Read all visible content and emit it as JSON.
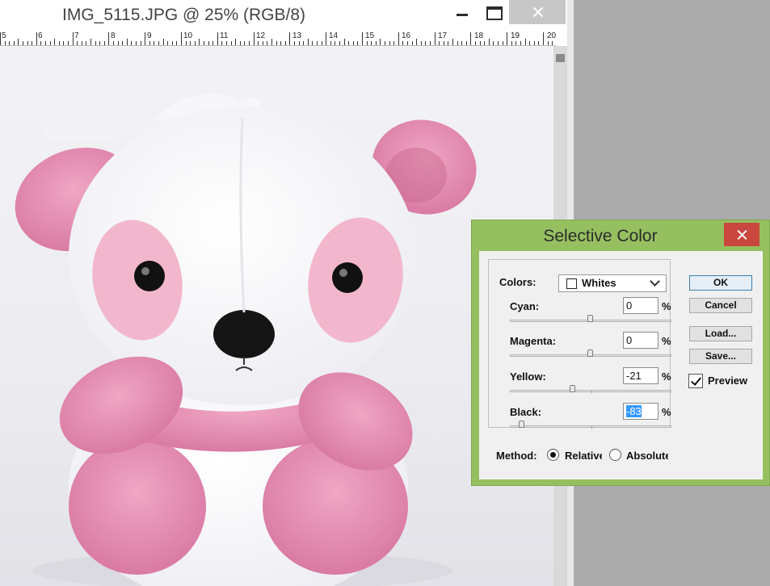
{
  "document": {
    "title": "IMG_5115.JPG @ 25% (RGB/8)",
    "ruler_labels": [
      "5",
      "6",
      "7",
      "8",
      "9",
      "10",
      "11",
      "12",
      "13",
      "14",
      "15",
      "16",
      "17",
      "18",
      "19",
      "20"
    ]
  },
  "colors": {
    "dialog_frame": "#96c060",
    "close_red": "#c9473e",
    "selection_blue": "#3399ff",
    "plush_pink": "#e58db0",
    "plush_white": "#ffffff"
  },
  "dialog": {
    "title": "Selective Color",
    "colors_label": "Colors:",
    "colors_value": "Whites",
    "sliders": [
      {
        "label": "Cyan:",
        "value": "0",
        "unit": "%"
      },
      {
        "label": "Magenta:",
        "value": "0",
        "unit": "%"
      },
      {
        "label": "Yellow:",
        "value": "-21",
        "unit": "%"
      },
      {
        "label": "Black:",
        "value": "-83",
        "unit": "%"
      }
    ],
    "buttons": {
      "ok": "OK",
      "cancel": "Cancel",
      "load": "Load...",
      "save": "Save..."
    },
    "preview_label": "Preview",
    "preview_checked": true,
    "method_label": "Method:",
    "method_options": [
      "Relative",
      "Absolute"
    ],
    "method_selected": "Relative"
  },
  "icons": [
    "minimize-icon",
    "maximize-icon",
    "close-icon",
    "dropdown-chevron-icon",
    "checkmark-icon"
  ]
}
